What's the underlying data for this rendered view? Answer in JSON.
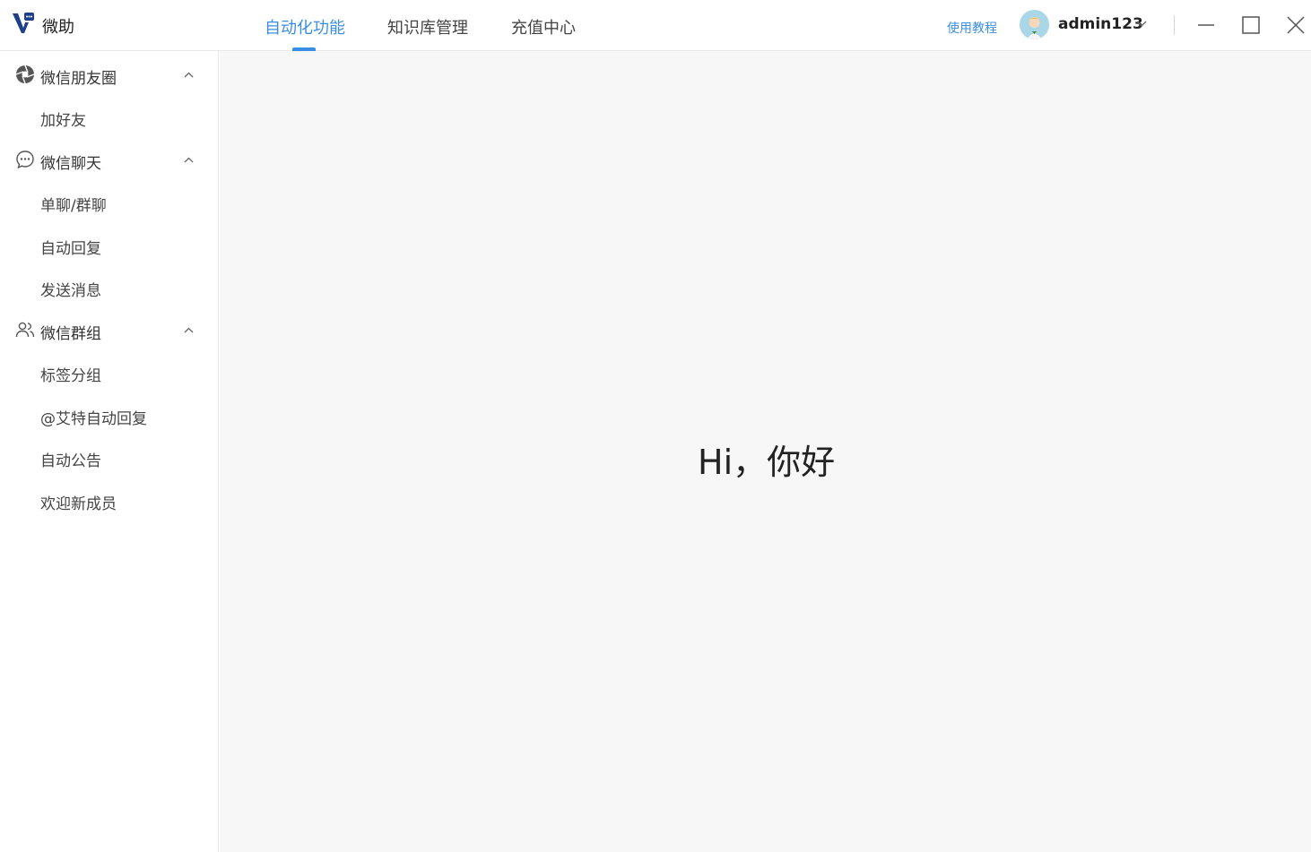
{
  "app": {
    "name": "微助",
    "colors": {
      "accent": "#3a8ee6",
      "main_bg": "#f7f7f7",
      "logo": "#1f3f8a"
    }
  },
  "header": {
    "tabs": [
      {
        "label": "自动化功能",
        "active": true
      },
      {
        "label": "知识库管理",
        "active": false
      },
      {
        "label": "充值中心",
        "active": false
      }
    ],
    "tutorial_link": "使用教程",
    "user": {
      "name": "admin123",
      "avatar_icon": "avatar-icon"
    },
    "window_controls": [
      "minimize-icon",
      "maximize-icon",
      "close-icon"
    ]
  },
  "sidebar": {
    "groups": [
      {
        "label": "微信朋友圈",
        "icon": "moments-icon",
        "expanded": true,
        "items": [
          "加好友"
        ]
      },
      {
        "label": "微信聊天",
        "icon": "chat-icon",
        "expanded": true,
        "items": [
          "单聊/群聊",
          "自动回复",
          "发送消息"
        ]
      },
      {
        "label": "微信群组",
        "icon": "group-icon",
        "expanded": true,
        "items": [
          "标签分组",
          "@艾特自动回复",
          "自动公告",
          "欢迎新成员"
        ]
      }
    ]
  },
  "main": {
    "greeting": "Hi，你好"
  }
}
